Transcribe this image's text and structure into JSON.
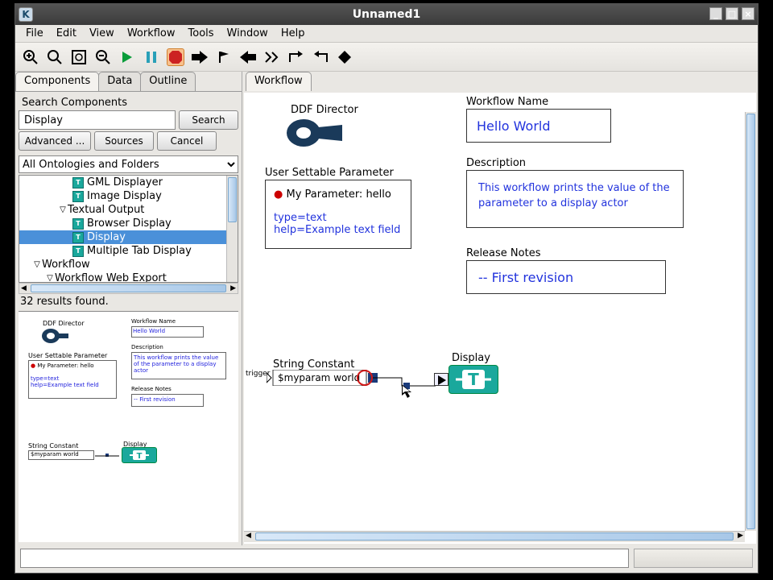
{
  "window": {
    "title": "Unnamed1",
    "appLetter": "K"
  },
  "menus": [
    "File",
    "Edit",
    "View",
    "Workflow",
    "Tools",
    "Window",
    "Help"
  ],
  "left_tabs": [
    "Components",
    "Data",
    "Outline"
  ],
  "right_tabs": [
    "Workflow"
  ],
  "search": {
    "heading": "Search Components",
    "value": "Display",
    "search_btn": "Search",
    "adv_btn": "Advanced ...",
    "sources_btn": "Sources",
    "cancel_btn": "Cancel",
    "combo": "All Ontologies and Folders"
  },
  "tree": {
    "items": [
      {
        "indent": 66,
        "icon": true,
        "label": "GML Displayer"
      },
      {
        "indent": 66,
        "icon": true,
        "label": "Image Display"
      },
      {
        "indent": 48,
        "expander": "▽",
        "label": "Textual Output"
      },
      {
        "indent": 66,
        "icon": true,
        "label": "Browser Display"
      },
      {
        "indent": 66,
        "icon": true,
        "label": "Display",
        "sel": true
      },
      {
        "indent": 66,
        "icon": true,
        "label": "Multiple Tab Display"
      },
      {
        "indent": 16,
        "expander": "▽",
        "label": "Workflow"
      },
      {
        "indent": 32,
        "expander": "▽",
        "label": "Workflow Web Export"
      }
    ],
    "results": "32 results found."
  },
  "canvas": {
    "director_label": "DDF Director",
    "param_box_label": "User Settable Parameter",
    "param_line": "My Parameter: hello",
    "param_type": "type=text",
    "param_help": "help=Example text field",
    "wf_name_lbl": "Workflow Name",
    "wf_name_val": "Hello World",
    "desc_lbl": "Description",
    "desc_val": "This workflow prints the value of the parameter to a display actor",
    "rel_lbl": "Release Notes",
    "rel_val": "-- First revision",
    "string_const_lbl": "String Constant",
    "string_const_val": "$myparam world",
    "trigger_lbl": "trigger",
    "display_lbl": "Display"
  },
  "preview": {
    "director_label": "DDF Director",
    "param_box_label": "User Settable Parameter",
    "param_line": "My Parameter: hello",
    "param_type": "type=text",
    "param_help": "help=Example text field",
    "wf_name_lbl": "Workflow Name",
    "wf_name_val": "Hello World",
    "desc_lbl": "Description",
    "desc_val": "This workflow prints the value of the parameter to a display actor",
    "rel_lbl": "Release Notes",
    "rel_val": "-- First revision",
    "string_const_lbl": "String Constant",
    "string_const_val": "$myparam world",
    "display_lbl": "Display"
  }
}
